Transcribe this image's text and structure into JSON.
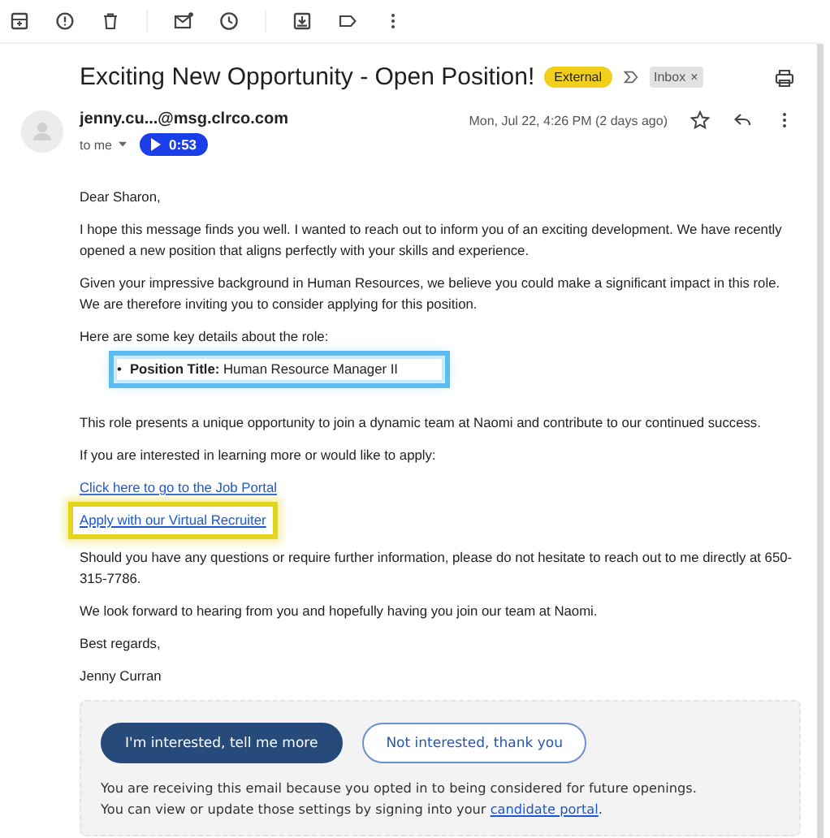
{
  "subject": {
    "title": "Exciting New Opportunity - Open Position!",
    "labels": [
      {
        "kind": "external",
        "text": "External"
      },
      {
        "kind": "folder",
        "text": "Inbox",
        "remove": "×"
      }
    ]
  },
  "sender": {
    "address": "jenny.cu...@msg.clrco.com",
    "to": "to me",
    "audio": "0:53",
    "date": "Mon, Jul 22, 4:26 PM (2 days ago)",
    "starred": false
  },
  "body": [
    {
      "kind": "paragraph",
      "text": "Dear Sharon,"
    },
    {
      "kind": "paragraph",
      "text": "I hope this message finds you well. I wanted to reach out to inform you of an exciting development. We have recently opened a new position that aligns perfectly with your skills and experience."
    },
    {
      "kind": "paragraph",
      "text": "Given your impressive background in Human Resources, we believe you could make a significant impact in this role. We are therefore inviting you to consider applying for this position."
    },
    {
      "kind": "paragraph",
      "text": "Here are some key details about the role:"
    },
    {
      "kind": "list",
      "items": [
        {
          "bullet": "•",
          "text": "**Position Title:** Human Resource Manager II",
          "highlighted": true
        }
      ]
    },
    {
      "kind": "paragraph",
      "text": "This role presents a unique opportunity to join a dynamic team at Naomi and contribute to our continued success."
    },
    {
      "kind": "paragraph",
      "text": "If you are interested in learning more or would like to apply:"
    },
    {
      "kind": "link",
      "text": "Click here to go to the Job Portal",
      "highlighted": false
    },
    {
      "kind": "link",
      "text": "Apply with our Virtual Recruiter",
      "highlighted": true
    },
    {
      "kind": "paragraph",
      "text": "Should you have any questions or require further information, please do not hesitate to reach out to me directly at 650-315-7786."
    },
    {
      "kind": "paragraph",
      "text": "We look forward to hearing from you and hopefully having you join our team at Naomi."
    },
    {
      "kind": "paragraph",
      "text": "Best regards,"
    },
    {
      "kind": "paragraph",
      "text": "Jenny Curran"
    }
  ],
  "footer": {
    "buttons": [
      {
        "kind": "primary",
        "label": "I'm interested, tell me more"
      },
      {
        "kind": "secondary",
        "label": "Not interested, thank you"
      }
    ],
    "notice": "You are receiving this email because you opted in to being considered for future openings.",
    "notice_2": "You can view or update those settings by signing into your",
    "notice_link": "candidate portal",
    "notice_end": "."
  }
}
